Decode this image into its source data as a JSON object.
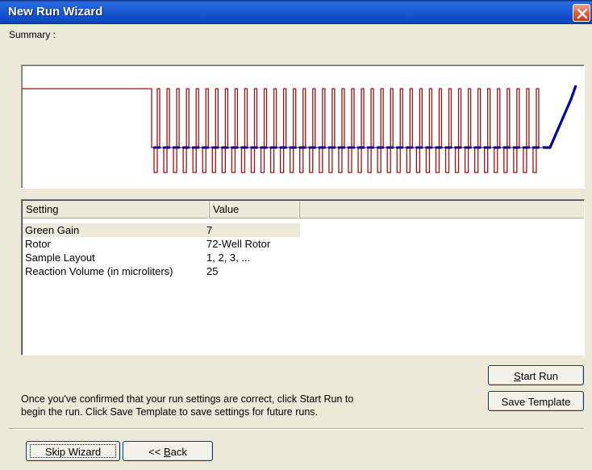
{
  "window": {
    "title": "New Run Wizard"
  },
  "summary": {
    "label": "Summary :"
  },
  "profile_chart": {
    "initial_hold": 1,
    "cycles": 40,
    "ramp": "final melt ramp",
    "colors": {
      "profile": "#a01010",
      "acquisition": "#0000a0"
    }
  },
  "settings_table": {
    "columns": [
      "Setting",
      "Value"
    ],
    "rows": [
      {
        "setting": "Green Gain",
        "value": "7"
      },
      {
        "setting": "Rotor",
        "value": "72-Well Rotor"
      },
      {
        "setting": "Sample Layout",
        "value": "1, 2, 3, ..."
      },
      {
        "setting": "Reaction Volume (in microliters)",
        "value": "25"
      }
    ]
  },
  "buttons": {
    "start_run": {
      "pre": "",
      "underline": "S",
      "post": "tart Run"
    },
    "save_template": "Save Template",
    "skip_wizard": "Skip Wizard",
    "back": {
      "pre": "<< ",
      "underline": "B",
      "post": "ack"
    }
  },
  "info": {
    "line1": "Once you've confirmed that your run settings are correct, click Start Run to",
    "line2": "begin the run. Click Save Template to save settings for future runs."
  }
}
